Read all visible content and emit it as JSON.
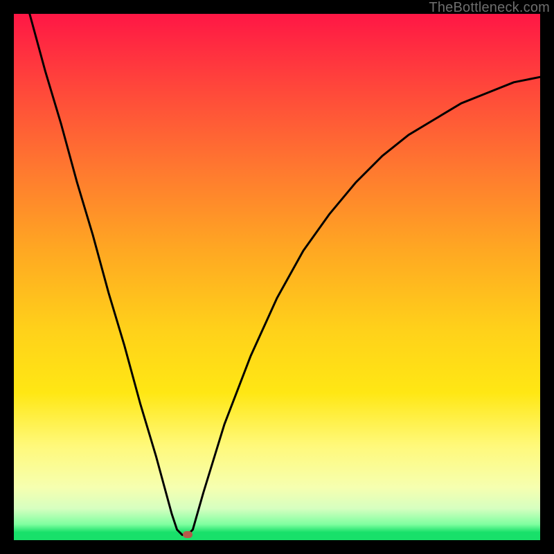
{
  "watermark": "TheBottleneck.com",
  "colors": {
    "frame": "#000000",
    "curve": "#000000",
    "marker": "#b45a4a",
    "gradient_top": "#ff1745",
    "gradient_bottom": "#18e06a"
  },
  "chart_data": {
    "type": "line",
    "title": "",
    "xlabel": "",
    "ylabel": "",
    "xlim": [
      0,
      100
    ],
    "ylim": [
      0,
      100
    ],
    "grid": false,
    "series": [
      {
        "name": "bottleneck-curve",
        "x": [
          3,
          6,
          9,
          12,
          15,
          18,
          21,
          24,
          27,
          30,
          31,
          32,
          33,
          34,
          36,
          40,
          45,
          50,
          55,
          60,
          65,
          70,
          75,
          80,
          85,
          90,
          95,
          100
        ],
        "y": [
          100,
          89,
          79,
          68,
          58,
          47,
          37,
          26,
          16,
          5,
          2,
          1,
          1,
          2,
          9,
          22,
          35,
          46,
          55,
          62,
          68,
          73,
          77,
          80,
          83,
          85,
          87,
          88
        ]
      }
    ],
    "annotations": [
      {
        "name": "optimal-point",
        "x": 33,
        "y": 1
      }
    ]
  }
}
